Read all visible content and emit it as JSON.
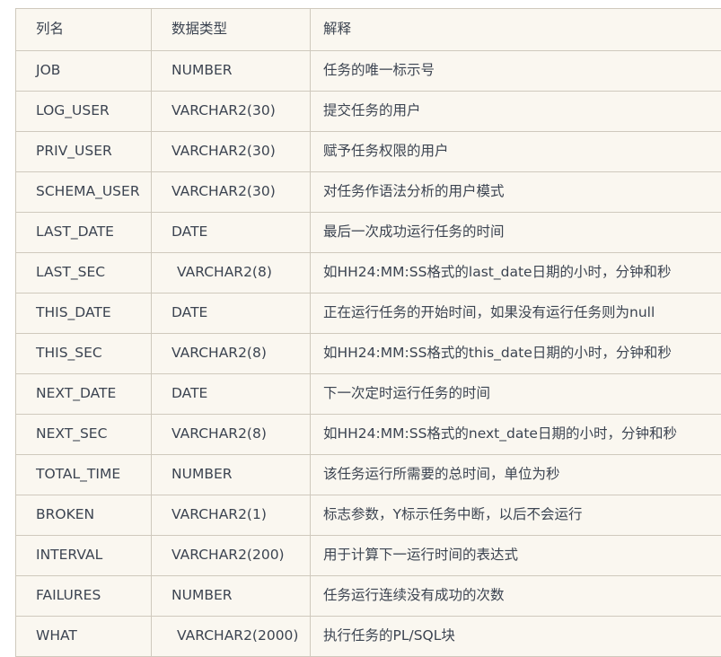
{
  "table": {
    "headers": [
      "列名",
      "数据类型",
      "解释"
    ],
    "rows": [
      {
        "name": "JOB",
        "type": "NUMBER",
        "type_indented": false,
        "desc": "任务的唯一标示号"
      },
      {
        "name": "LOG_USER",
        "type": "VARCHAR2(30)",
        "type_indented": false,
        "desc": "提交任务的用户"
      },
      {
        "name": "PRIV_USER",
        "type": "VARCHAR2(30)",
        "type_indented": false,
        "desc": "赋予任务权限的用户"
      },
      {
        "name": "SCHEMA_USER",
        "type": "VARCHAR2(30)",
        "type_indented": false,
        "desc": "对任务作语法分析的用户模式"
      },
      {
        "name": "LAST_DATE",
        "type": "DATE",
        "type_indented": false,
        "desc": "最后一次成功运行任务的时间"
      },
      {
        "name": "LAST_SEC",
        "type": "VARCHAR2(8)",
        "type_indented": true,
        "desc": "如HH24:MM:SS格式的last_date日期的小时，分钟和秒"
      },
      {
        "name": "THIS_DATE",
        "type": "DATE",
        "type_indented": false,
        "desc": "正在运行任务的开始时间，如果没有运行任务则为null"
      },
      {
        "name": "THIS_SEC",
        "type": "VARCHAR2(8)",
        "type_indented": false,
        "desc": "如HH24:MM:SS格式的this_date日期的小时，分钟和秒"
      },
      {
        "name": "NEXT_DATE",
        "type": "DATE",
        "type_indented": false,
        "desc": "下一次定时运行任务的时间"
      },
      {
        "name": "NEXT_SEC",
        "type": "VARCHAR2(8)",
        "type_indented": false,
        "desc": "如HH24:MM:SS格式的next_date日期的小时，分钟和秒"
      },
      {
        "name": "TOTAL_TIME",
        "type": "NUMBER",
        "type_indented": false,
        "desc": "该任务运行所需要的总时间，单位为秒"
      },
      {
        "name": "BROKEN",
        "type": "VARCHAR2(1)",
        "type_indented": false,
        "desc": "标志参数，Y标示任务中断，以后不会运行"
      },
      {
        "name": "INTERVAL",
        "type": "VARCHAR2(200)",
        "type_indented": false,
        "desc": "用于计算下一运行时间的表达式"
      },
      {
        "name": "FAILURES",
        "type": "NUMBER",
        "type_indented": false,
        "desc": "任务运行连续没有成功的次数"
      },
      {
        "name": "WHAT",
        "type": "VARCHAR2(2000)",
        "type_indented": true,
        "desc": "执行任务的PL/SQL块"
      }
    ]
  },
  "colors": {
    "cell_background": "#faf7f0",
    "border": "#cfc9bd",
    "text": "#3c4451",
    "page_background": "#ffffff"
  }
}
